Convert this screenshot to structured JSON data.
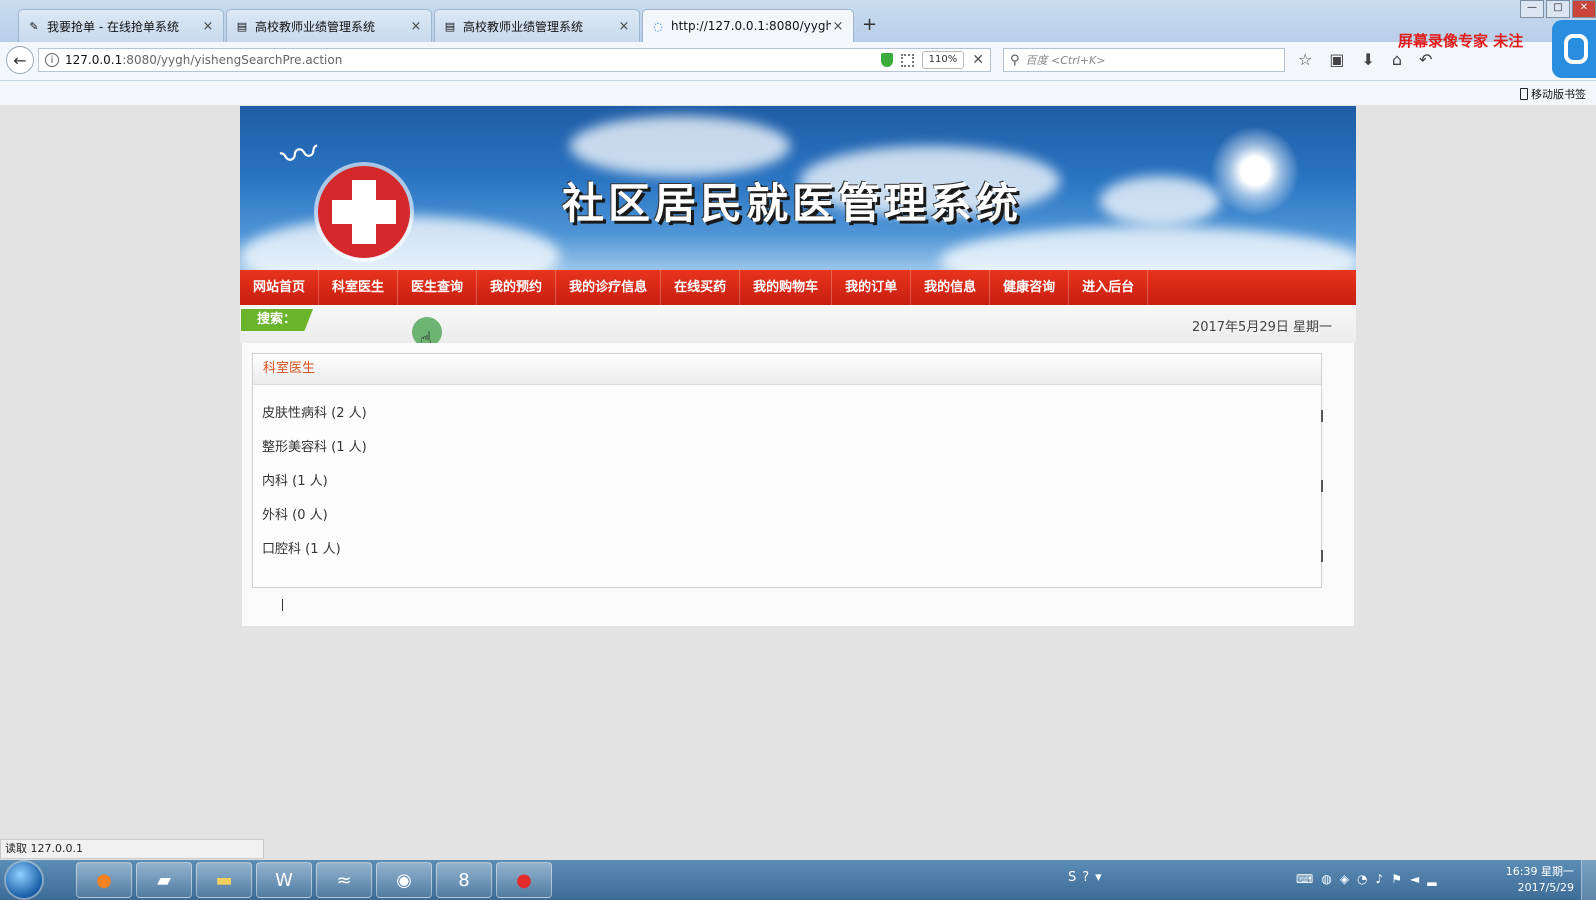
{
  "browser": {
    "tabs": [
      {
        "title": "我要抢单 - 在线抢单系统",
        "close": "×"
      },
      {
        "title": "高校教师业绩管理系统",
        "close": "×"
      },
      {
        "title": "高校教师业绩管理系统",
        "close": "×"
      },
      {
        "title": "http://127.0.0.1:8080/yygh",
        "close": "×"
      }
    ],
    "new_tab": "+",
    "url_host": "127.0.0.1",
    "url_path": ":8080/yygh/yishengSearchPre.action",
    "zoom": "110%",
    "search_placeholder": "百度 <Ctrl+K>",
    "recorder_watermark": "屏幕录像专家 未注",
    "mobile_bookmarks": "移动版书签",
    "status": "读取 127.0.0.1"
  },
  "site": {
    "title": "社区居民就医管理系统",
    "menu": [
      "网站首页",
      "科室医生",
      "医生查询",
      "我的预约",
      "我的诊疗信息",
      "在线买药",
      "我的购物车",
      "我的订单",
      "我的信息",
      "健康咨询",
      "进入后台"
    ],
    "search_label": "搜索：",
    "date": "2017年5月29日 星期一"
  },
  "panel": {
    "title": "科室医生",
    "departments": [
      {
        "name": "皮肤性病科",
        "count": "(2 人)"
      },
      {
        "name": "整形美容科",
        "count": "(1 人)"
      },
      {
        "name": "内科",
        "count": "(1 人)"
      },
      {
        "name": "外科",
        "count": "(0 人)"
      },
      {
        "name": "口腔科",
        "count": "(1 人)"
      }
    ]
  },
  "taskbar": {
    "clock_time": "16:39 星期一",
    "clock_date": "2017/5/29"
  },
  "colors": {
    "menu_red": "#d8291a",
    "search_green": "#69b42b",
    "panel_title_orange": "#d6541f"
  }
}
